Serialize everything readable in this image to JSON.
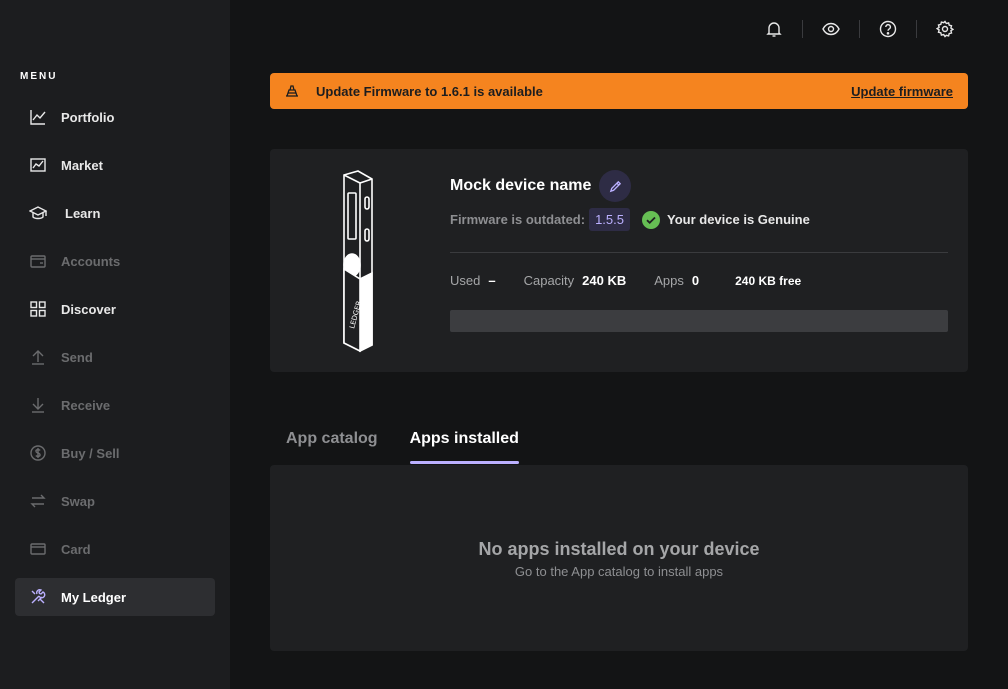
{
  "sidebar": {
    "menu_title": "MENU",
    "items": [
      {
        "label": "Portfolio",
        "icon": "portfolio-icon"
      },
      {
        "label": "Market",
        "icon": "market-icon"
      },
      {
        "label": "Learn",
        "icon": "learn-icon"
      },
      {
        "label": "Accounts",
        "icon": "wallet-icon"
      },
      {
        "label": "Discover",
        "icon": "grid-icon"
      },
      {
        "label": "Send",
        "icon": "arrow-up-icon"
      },
      {
        "label": "Receive",
        "icon": "arrow-down-icon"
      },
      {
        "label": "Buy / Sell",
        "icon": "dollar-icon"
      },
      {
        "label": "Swap",
        "icon": "swap-icon"
      },
      {
        "label": "Card",
        "icon": "card-icon"
      },
      {
        "label": "My Ledger",
        "icon": "tools-icon"
      }
    ],
    "active_item": "My Ledger"
  },
  "topbar": {
    "icons": [
      "bell-icon",
      "eye-icon",
      "help-icon",
      "gear-icon"
    ]
  },
  "banner": {
    "message": "Update Firmware to 1.6.1 is available",
    "link_label": "Update firmware",
    "color": "#f5841f"
  },
  "device": {
    "name": "Mock device name",
    "firmware_label": "Firmware is outdated:",
    "firmware_version": "1.5.5",
    "genuine_text": "Your device is Genuine",
    "used_label": "Used",
    "used_value": "–",
    "capacity_label": "Capacity",
    "capacity_value": "240 KB",
    "apps_label": "Apps",
    "apps_value": "0",
    "free_text": "240 KB free",
    "brand_text": "LEDGER",
    "storage_used_fraction": 0
  },
  "tabs": {
    "catalog": "App catalog",
    "installed": "Apps installed",
    "active": "Apps installed"
  },
  "apps_panel": {
    "empty_title": "No apps installed on your device",
    "empty_subtitle": "Go to the App catalog to install apps"
  },
  "colors": {
    "accent": "#bbb0ff",
    "genuine_green": "#66be54",
    "warning": "#f5841f"
  }
}
